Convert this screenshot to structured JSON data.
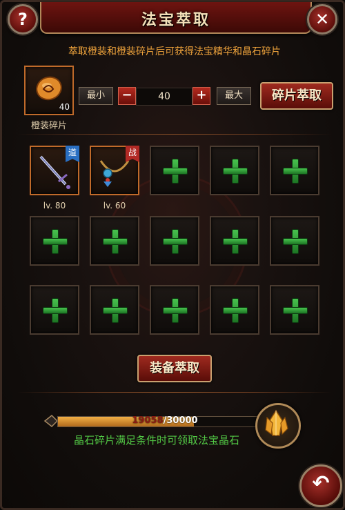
{
  "header": {
    "title": "法宝萃取",
    "help_label": "?",
    "close_label": "✕"
  },
  "info_text": "萃取橙装和橙装碎片后可获得法宝精华和晶石碎片",
  "fragment": {
    "count": "40",
    "label": "橙装碎片"
  },
  "quantity": {
    "min_label": "最小",
    "max_label": "最大",
    "minus": "−",
    "plus": "+",
    "value": "40"
  },
  "fragment_extract_button": "碎片萃取",
  "equipment": [
    {
      "level": "lv. 80",
      "badge": "道"
    },
    {
      "level": "lv. 60",
      "badge": "战"
    }
  ],
  "empty_slot_count": 13,
  "equip_extract_button": "装备萃取",
  "progress": {
    "current": "19058",
    "separator": "/",
    "max": "30000",
    "fraction": 0.635
  },
  "hint_text": "晶石碎片满足条件时可领取法宝晶石",
  "back_label": "↶",
  "colors": {
    "accent_red": "#9f2a1f",
    "gold": "#c9a170",
    "green": "#52c845",
    "orange_text": "#f0a43c"
  }
}
